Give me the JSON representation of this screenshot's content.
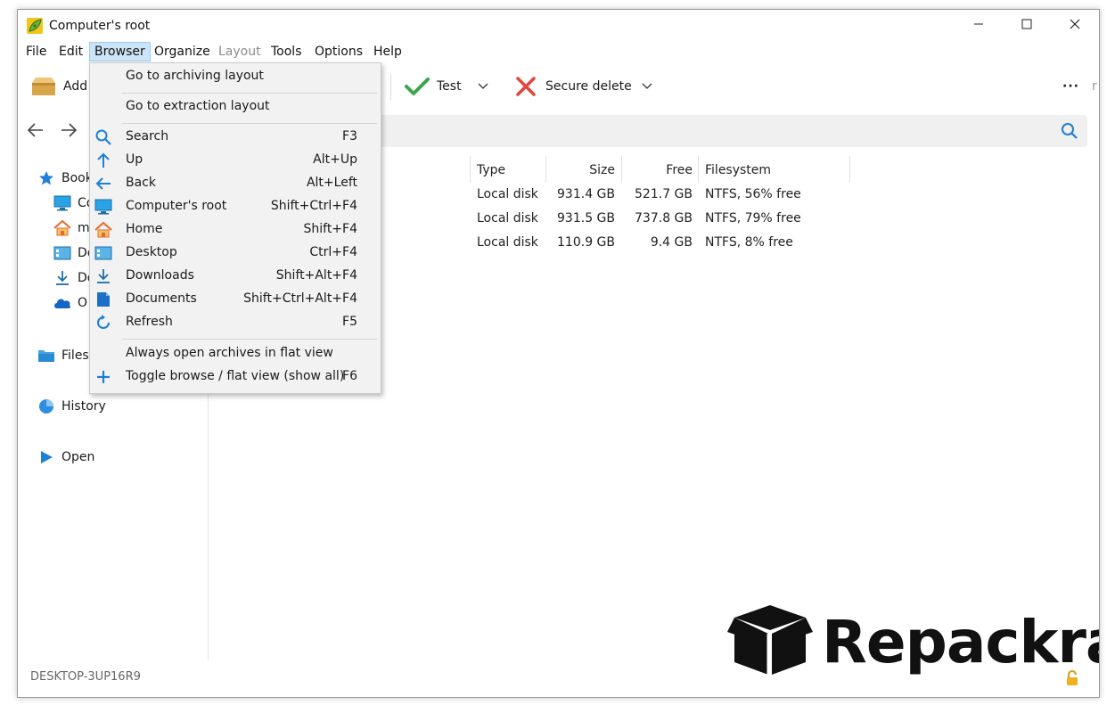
{
  "window": {
    "title": "Computer's root",
    "controls": {
      "minimize": "minimize-icon",
      "maximize": "maximize-icon",
      "close": "close-icon"
    }
  },
  "menubar": {
    "items": [
      {
        "label": "File"
      },
      {
        "label": "Edit"
      },
      {
        "label": "Browser",
        "active": true
      },
      {
        "label": "Organize"
      },
      {
        "label": "Layout",
        "disabled": true
      },
      {
        "label": "Tools"
      },
      {
        "label": "Options"
      },
      {
        "label": "Help"
      }
    ]
  },
  "toolbar": {
    "add_label": "Add",
    "test_label": "Test",
    "secure_delete_label": "Secure delete",
    "more_label": "···",
    "edge_fragment": "r"
  },
  "sidebar": {
    "bookmarks": "Book",
    "bookmark_items": [
      {
        "label": "Co",
        "icon": "computer-icon"
      },
      {
        "label": "m",
        "icon": "home-icon"
      },
      {
        "label": "De",
        "icon": "desktop-icon"
      },
      {
        "label": "Do",
        "icon": "downloads-icon"
      },
      {
        "label": "O",
        "icon": "onedrive-icon"
      }
    ],
    "filesystem": "Filesy",
    "history": "History",
    "open": "Open"
  },
  "table": {
    "headers": {
      "type": "Type",
      "size": "Size",
      "free": "Free",
      "filesystem": "Filesystem"
    },
    "rows": [
      {
        "type": "Local disk",
        "size": "931.4 GB",
        "free": "521.7 GB",
        "filesystem": "NTFS, 56% free"
      },
      {
        "type": "Local disk",
        "size": "931.5 GB",
        "free": "737.8 GB",
        "filesystem": "NTFS, 79% free"
      },
      {
        "type": "Local disk",
        "size": "110.9 GB",
        "free": "9.4 GB",
        "filesystem": "NTFS, 8% free"
      }
    ]
  },
  "status": {
    "computer_name": "DESKTOP-3UP16R9"
  },
  "browser_menu": {
    "items": [
      {
        "label": "Go to archiving layout",
        "shortcut": "",
        "icon": ""
      },
      {
        "label": "Go to extraction layout",
        "shortcut": "",
        "icon": ""
      },
      {
        "label": "Search",
        "shortcut": "F3",
        "icon": "search-icon"
      },
      {
        "label": "Up",
        "shortcut": "Alt+Up",
        "icon": "arrow-up-icon"
      },
      {
        "label": "Back",
        "shortcut": "Alt+Left",
        "icon": "arrow-left-icon"
      },
      {
        "label": "Computer's root",
        "shortcut": "Shift+Ctrl+F4",
        "icon": "computer-icon"
      },
      {
        "label": "Home",
        "shortcut": "Shift+F4",
        "icon": "home-icon"
      },
      {
        "label": "Desktop",
        "shortcut": "Ctrl+F4",
        "icon": "desktop-icon"
      },
      {
        "label": "Downloads",
        "shortcut": "Shift+Alt+F4",
        "icon": "downloads-icon"
      },
      {
        "label": "Documents",
        "shortcut": "Shift+Ctrl+Alt+F4",
        "icon": "documents-icon"
      },
      {
        "label": "Refresh",
        "shortcut": "F5",
        "icon": "refresh-icon"
      },
      {
        "label": "Always open archives in flat view",
        "shortcut": "",
        "icon": ""
      },
      {
        "label": "Toggle browse / flat view (show all)",
        "shortcut": "F6",
        "icon": "plus-icon"
      }
    ]
  },
  "watermark": {
    "text": "Repackra"
  },
  "colors": {
    "accent": "#1e7fd6",
    "check": "#3aa64a",
    "delete": "#e0463a",
    "menu_highlight": "#cce4f7"
  }
}
